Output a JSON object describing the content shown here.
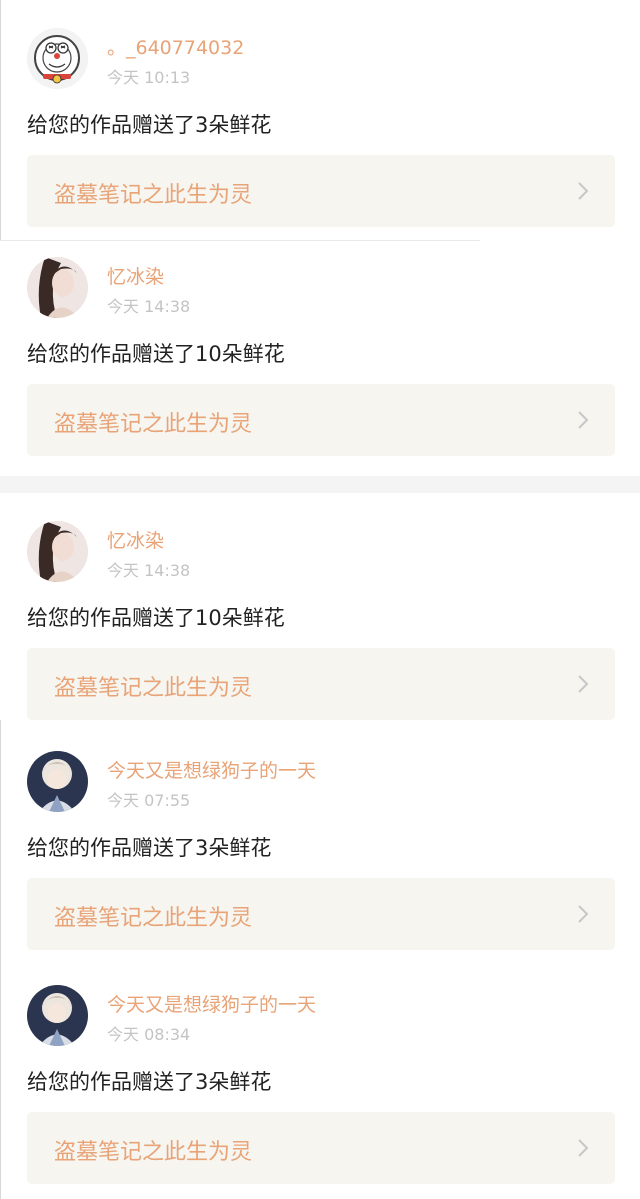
{
  "notifications": [
    {
      "user": "。_640774032",
      "avatar_icon": "doraemon-cartoon-avatar",
      "time": "今天 10:13",
      "message": "给您的作品赠送了3朵鲜花",
      "work_title": "盗墓笔记之此生为灵"
    },
    {
      "user": "忆冰染",
      "avatar_icon": "girl-portrait-avatar",
      "time": "今天 14:38",
      "message": "给您的作品赠送了10朵鲜花",
      "work_title": "盗墓笔记之此生为灵"
    },
    {
      "user": "忆冰染",
      "avatar_icon": "girl-portrait-avatar",
      "time": "今天 14:38",
      "message": "给您的作品赠送了10朵鲜花",
      "work_title": "盗墓笔记之此生为灵"
    },
    {
      "user": "今天又是想绿狗子的一天",
      "avatar_icon": "anime-character-avatar",
      "time": "今天 07:55",
      "message": "给您的作品赠送了3朵鲜花",
      "work_title": "盗墓笔记之此生为灵"
    },
    {
      "user": "今天又是想绿狗子的一天",
      "avatar_icon": "anime-character-avatar",
      "time": "今天 08:34",
      "message": "给您的作品赠送了3朵鲜花",
      "work_title": "盗墓笔记之此生为灵"
    }
  ],
  "colors": {
    "accent": "#e8a377",
    "time": "#c4c4c4",
    "message": "#222222",
    "card_bg": "#f7f5f0"
  }
}
